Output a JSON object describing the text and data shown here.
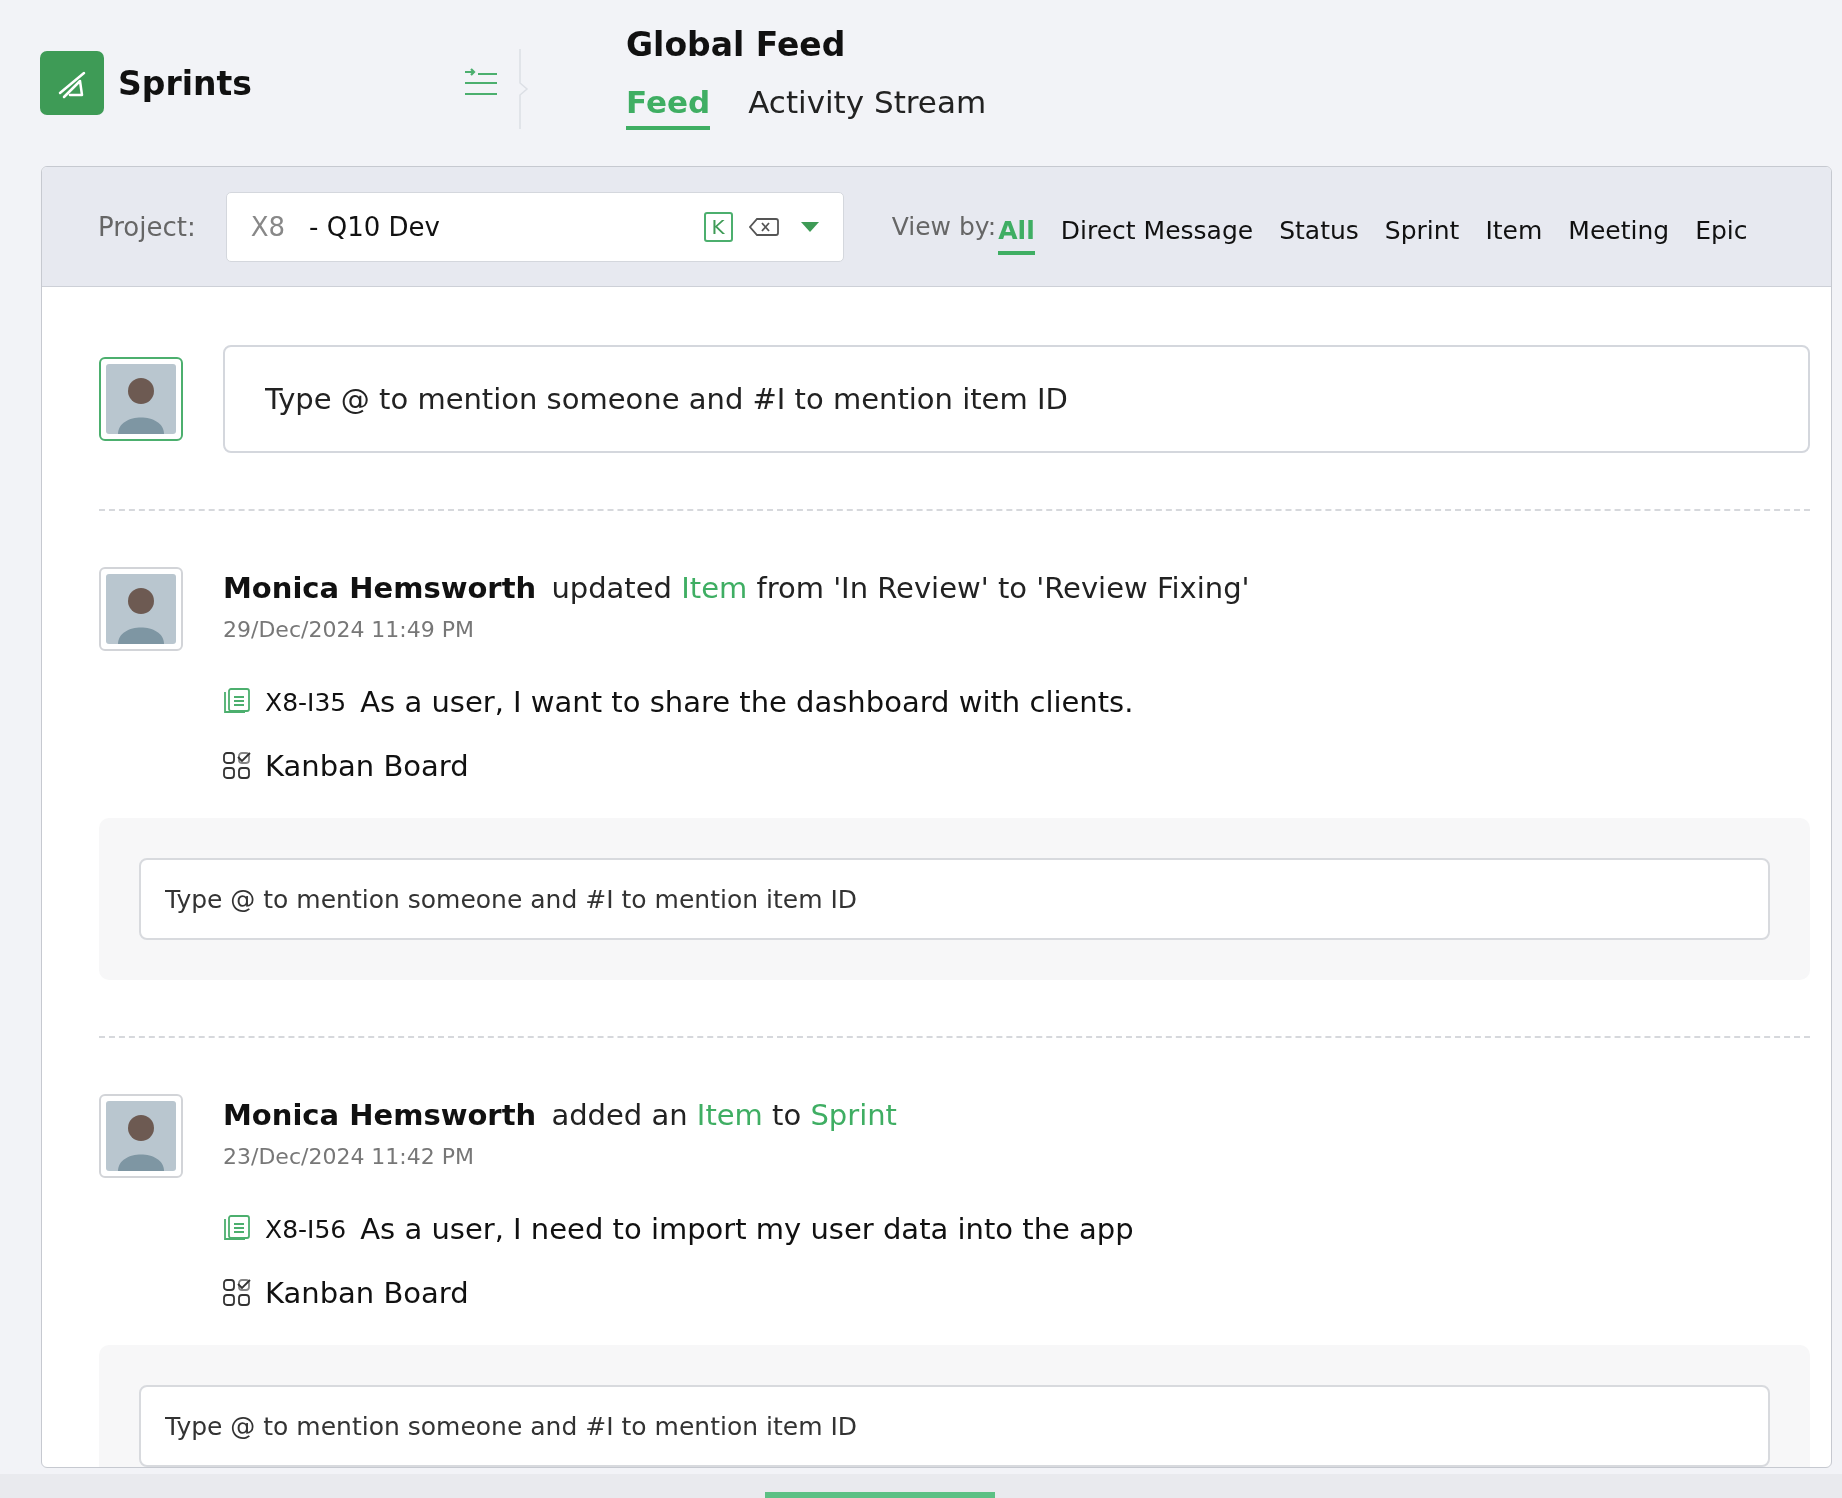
{
  "app": {
    "name": "Sprints"
  },
  "page": {
    "title": "Global Feed"
  },
  "tabs": [
    {
      "label": "Feed",
      "selected": true
    },
    {
      "label": "Activity Stream",
      "selected": false
    }
  ],
  "filter": {
    "project_label": "Project:",
    "project_key": "X8",
    "project_name": "- Q10 Dev",
    "key_badge": "K",
    "view_by_label": "View by:",
    "view_options": [
      {
        "label": "All",
        "selected": true
      },
      {
        "label": "Direct Message",
        "selected": false
      },
      {
        "label": "Status",
        "selected": false
      },
      {
        "label": "Sprint",
        "selected": false
      },
      {
        "label": "Item",
        "selected": false
      },
      {
        "label": "Meeting",
        "selected": false
      },
      {
        "label": "Epic",
        "selected": false
      }
    ]
  },
  "composer": {
    "placeholder": "Type @ to mention someone and #I to mention item ID"
  },
  "feed": [
    {
      "actor": "Monica Hemsworth",
      "action": [
        {
          "kind": "plain",
          "text": "updated"
        },
        {
          "kind": "link",
          "text": "Item"
        },
        {
          "kind": "plain",
          "text": "from 'In Review' to 'Review Fixing'"
        }
      ],
      "time": "29/Dec/2024 11:49 PM",
      "item_id": "X8-I35",
      "item_title": "As a user, I want to share the dashboard with clients.",
      "board": "Kanban Board",
      "comment_placeholder": "Type @ to mention someone and #I to mention item ID"
    },
    {
      "actor": "Monica Hemsworth",
      "action": [
        {
          "kind": "plain",
          "text": "added an"
        },
        {
          "kind": "link",
          "text": "Item"
        },
        {
          "kind": "plain",
          "text": "to"
        },
        {
          "kind": "link",
          "text": "Sprint"
        }
      ],
      "time": "23/Dec/2024 11:42 PM",
      "item_id": "X8-I56",
      "item_title": "As a user, I need to import my user data into the app",
      "board": "Kanban Board",
      "comment_placeholder": "Type @ to mention someone and #I to mention item ID"
    }
  ]
}
